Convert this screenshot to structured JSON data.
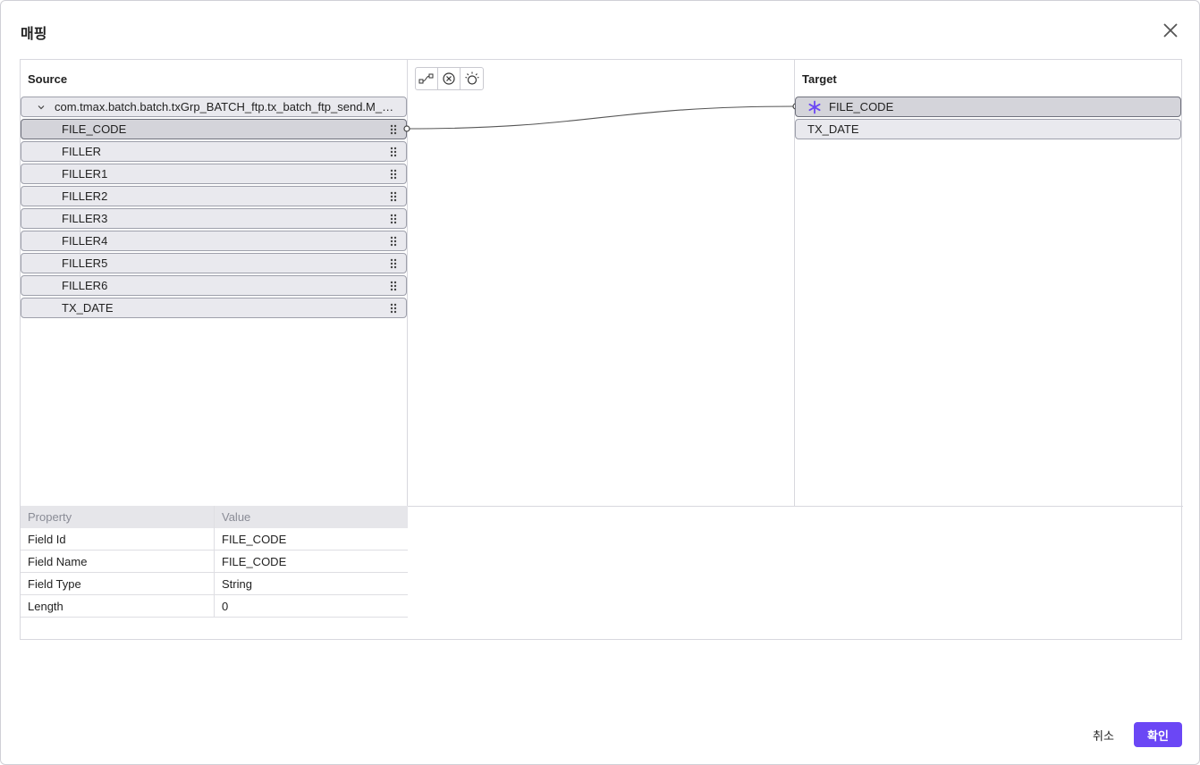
{
  "dialog": {
    "title": "매핑",
    "cancel_label": "취소",
    "ok_label": "확인"
  },
  "source": {
    "title": "Source",
    "tree_node": "com.tmax.batch.batch.txGrp_BATCH_ftp.tx_batch_ftp_send.M_BATCH_FTP_SEND",
    "fields": [
      "FILE_CODE",
      "FILLER",
      "FILLER1",
      "FILLER2",
      "FILLER3",
      "FILLER4",
      "FILLER5",
      "FILLER6",
      "TX_DATE"
    ],
    "selected_field": "FILE_CODE"
  },
  "target": {
    "title": "Target",
    "fields": [
      "FILE_CODE",
      "TX_DATE"
    ],
    "required_field": "FILE_CODE"
  },
  "toolbar": {
    "icons": [
      "auto-map-icon",
      "clear-mapping-icon",
      "highlight-icon"
    ]
  },
  "properties": {
    "headers": [
      "Property",
      "Value"
    ],
    "rows": [
      {
        "property": "Field Id",
        "value": "FILE_CODE"
      },
      {
        "property": "Field Name",
        "value": "FILE_CODE"
      },
      {
        "property": "Field Type",
        "value": "String"
      },
      {
        "property": "Length",
        "value": "0"
      }
    ]
  },
  "colors": {
    "accent": "#6b47f5",
    "row_bg": "#e9e9ee",
    "row_selected_bg": "#d4d4da"
  }
}
